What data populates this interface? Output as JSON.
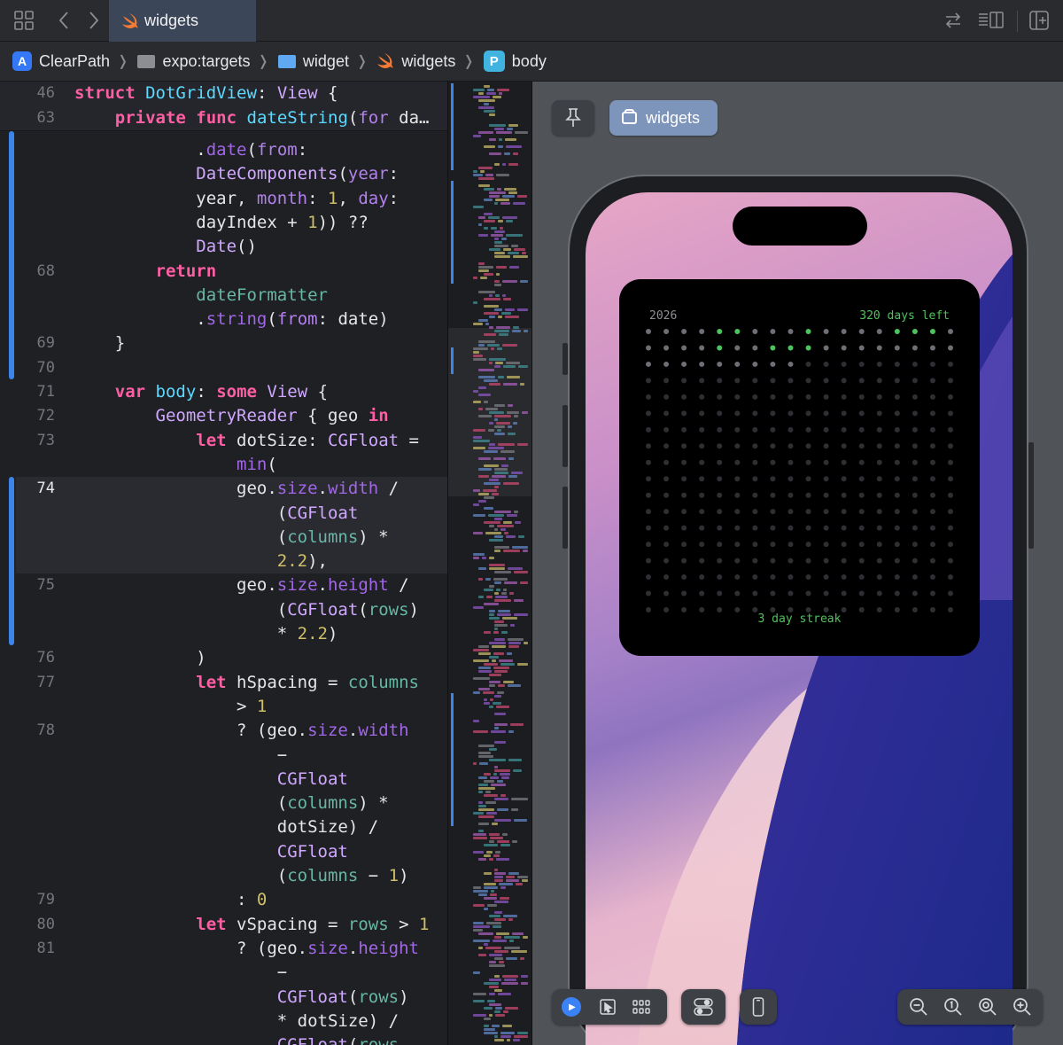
{
  "tabbar": {
    "active_tab": "widgets",
    "icons": [
      "grid-icon",
      "chevron-left-icon",
      "chevron-right-icon",
      "swap-icon",
      "inspector-icon",
      "add-editor-icon"
    ]
  },
  "breadcrumb": {
    "items": [
      "ClearPath",
      "expo:targets",
      "widget",
      "widgets",
      "body"
    ],
    "symbol_badge": "P"
  },
  "editor": {
    "sticky": [
      {
        "num": "46",
        "html": "<span class=\"kw\">struct</span> <span class=\"tyd\">DotGridView</span>: <span class=\"ty\">View</span> {"
      },
      {
        "num": "63",
        "html": "    <span class=\"kw\">private</span> <span class=\"kw\">func</span> <span class=\"tyd\">dateString</span>(<span class=\"prm\">for</span> da…"
      }
    ],
    "lines": [
      {
        "num": "",
        "html": "            .<span class=\"fn\">date</span>(<span class=\"prm\">from</span>:"
      },
      {
        "num": "",
        "html": "            <span class=\"ty\">DateComponents</span>(<span class=\"prm\">year</span>:"
      },
      {
        "num": "",
        "html": "            year, <span class=\"prm\">month</span>: <span class=\"num\">1</span>, <span class=\"prm\">day</span>:"
      },
      {
        "num": "",
        "html": "            dayIndex + <span class=\"num\">1</span>)) ??"
      },
      {
        "num": "",
        "html": "            <span class=\"ty\">Date</span>()"
      },
      {
        "num": "68",
        "html": "        <span class=\"kw\">return</span>"
      },
      {
        "num": "",
        "html": "            <span class=\"gr\">dateFormatter</span>"
      },
      {
        "num": "",
        "html": "            .<span class=\"fn\">string</span>(<span class=\"prm\">from</span>: date)"
      },
      {
        "num": "69",
        "html": "    }"
      },
      {
        "num": "70",
        "html": ""
      },
      {
        "num": "71",
        "html": "    <span class=\"kw\">var</span> <span class=\"tyd\">body</span>: <span class=\"kw\">some</span> <span class=\"ty\">View</span> {"
      },
      {
        "num": "72",
        "html": "        <span class=\"ty\">GeometryReader</span> { geo <span class=\"kw\">in</span>"
      },
      {
        "num": "73",
        "html": "            <span class=\"kw\">let</span> dotSize: <span class=\"ty\">CGFloat</span> ="
      },
      {
        "num": "",
        "html": "                <span class=\"fn\">min</span>("
      },
      {
        "num": "74",
        "html": "                geo.<span class=\"fn\">size</span>.<span class=\"fn\">width</span> /",
        "cur": true
      },
      {
        "num": "",
        "html": "                    (<span class=\"ty\">CGFloat</span>",
        "cur": true
      },
      {
        "num": "",
        "html": "                    (<span class=\"gr\">columns</span>) *",
        "cur": true
      },
      {
        "num": "",
        "html": "                    <span class=\"num\">2.2</span>),",
        "cur": true
      },
      {
        "num": "75",
        "html": "                geo.<span class=\"fn\">size</span>.<span class=\"fn\">height</span> /"
      },
      {
        "num": "",
        "html": "                    (<span class=\"ty\">CGFloat</span>(<span class=\"gr\">rows</span>)"
      },
      {
        "num": "",
        "html": "                    * <span class=\"num\">2.2</span>)"
      },
      {
        "num": "76",
        "html": "            )"
      },
      {
        "num": "77",
        "html": "            <span class=\"kw\">let</span> hSpacing = <span class=\"gr\">columns</span>"
      },
      {
        "num": "",
        "html": "                > <span class=\"num\">1</span>"
      },
      {
        "num": "78",
        "html": "                ? (geo.<span class=\"fn\">size</span>.<span class=\"fn\">width</span>"
      },
      {
        "num": "",
        "html": "                    −"
      },
      {
        "num": "",
        "html": "                    <span class=\"ty\">CGFloat</span>"
      },
      {
        "num": "",
        "html": "                    (<span class=\"gr\">columns</span>) *"
      },
      {
        "num": "",
        "html": "                    dotSize) /"
      },
      {
        "num": "",
        "html": "                    <span class=\"ty\">CGFloat</span>"
      },
      {
        "num": "",
        "html": "                    (<span class=\"gr\">columns</span> − <span class=\"num\">1</span>)"
      },
      {
        "num": "79",
        "html": "                : <span class=\"num\">0</span>"
      },
      {
        "num": "80",
        "html": "            <span class=\"kw\">let</span> vSpacing = <span class=\"gr\">rows</span> > <span class=\"num\">1</span>"
      },
      {
        "num": "81",
        "html": "                ? (geo.<span class=\"fn\">size</span>.<span class=\"fn\">height</span>"
      },
      {
        "num": "",
        "html": "                    −"
      },
      {
        "num": "",
        "html": "                    <span class=\"ty\">CGFloat</span>(<span class=\"gr\">rows</span>)"
      },
      {
        "num": "",
        "html": "                    * dotSize) /"
      },
      {
        "num": "",
        "html": "                    <span class=\"ty\">CGFloat</span>(<span class=\"gr\">rows</span>"
      }
    ]
  },
  "canvas": {
    "pin_label": "",
    "widgets_button": "widgets",
    "colors": {
      "accent": "#3b82f6",
      "dot_active": "#4fc25f",
      "dot_inactive": "#3a3b3f"
    }
  },
  "widget": {
    "year": "2026",
    "days_left": "320 days left",
    "streak": "3 day streak",
    "columns": 18,
    "rows": 18,
    "days_filled": 45,
    "active_days": [
      4,
      5,
      9,
      14,
      15,
      16,
      22,
      25,
      26,
      27
    ]
  }
}
